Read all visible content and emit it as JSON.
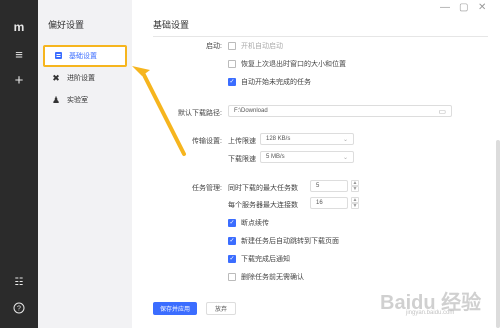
{
  "rail": {
    "logo_icon": "logo-mark",
    "icons": [
      "menu-icon",
      "plus-icon",
      "sliders-icon",
      "help-icon"
    ]
  },
  "sidebar": {
    "title": "偏好设置",
    "items": [
      {
        "label": "基础设置",
        "icon": "basic-settings-icon",
        "active": true
      },
      {
        "label": "进阶设置",
        "icon": "advanced-settings-icon",
        "active": false
      },
      {
        "label": "实验室",
        "icon": "lab-icon",
        "active": false
      }
    ]
  },
  "window_controls": [
    "minimize",
    "restore",
    "close"
  ],
  "page": {
    "title": "基础设置",
    "startup": {
      "label": "启动:",
      "options": [
        {
          "label": "开机自动启动",
          "checked": false
        },
        {
          "label": "恢复上次退出时窗口的大小和位置",
          "checked": false
        },
        {
          "label": "自动开始未完成的任务",
          "checked": true
        }
      ]
    },
    "download_path": {
      "label": "默认下载路径:",
      "value": "F:\\Download"
    },
    "transfer": {
      "label": "传输设置:",
      "upload_label": "上传限速",
      "upload_value": "128 KB/s",
      "download_label": "下载限速",
      "download_value": "5 MB/s"
    },
    "tasks": {
      "label": "任务管理:",
      "max_tasks_label": "同时下载的最大任务数",
      "max_tasks_value": "5",
      "max_conn_label": "每个服务器最大连接数",
      "max_conn_value": "16",
      "options": [
        {
          "label": "断点续传",
          "checked": true
        },
        {
          "label": "新建任务后自动跳转到下载页面",
          "checked": true
        },
        {
          "label": "下载完成后通知",
          "checked": true
        },
        {
          "label": "删除任务前无需确认",
          "checked": false
        }
      ]
    },
    "save_button": "保存并应用",
    "discard_button": "放弃"
  },
  "watermark": {
    "brand": "Baidu 经验",
    "url": "jingyan.baidu.com"
  },
  "colors": {
    "accent": "#3b6dff",
    "highlight": "#f6b51e",
    "rail_bg": "#2b2b2b"
  }
}
